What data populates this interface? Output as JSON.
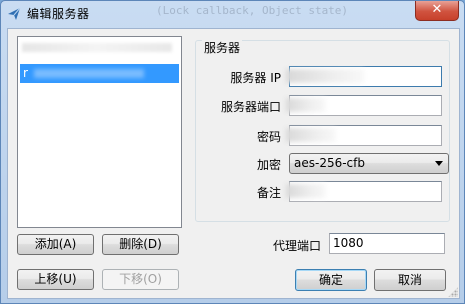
{
  "window": {
    "title": "编辑服务器",
    "ghost_text": "(Lock callback, Object state)",
    "close_symbol": "✕"
  },
  "list": {
    "selected_item": "r"
  },
  "buttons": {
    "add": "添加(A)",
    "delete": "删除(D)",
    "move_up": "上移(U)",
    "move_down": "下移(O)",
    "ok": "确定",
    "cancel": "取消"
  },
  "server_group": {
    "title": "服务器",
    "ip_label": "服务器 IP",
    "port_label": "服务器端口",
    "password_label": "密码",
    "encryption_label": "加密",
    "encryption_value": "aes-256-cfb",
    "remarks_label": "备注",
    "ip_value": "",
    "port_value": "",
    "password_value": "",
    "remarks_value": ""
  },
  "proxy": {
    "label": "代理端口",
    "value": "1080"
  }
}
